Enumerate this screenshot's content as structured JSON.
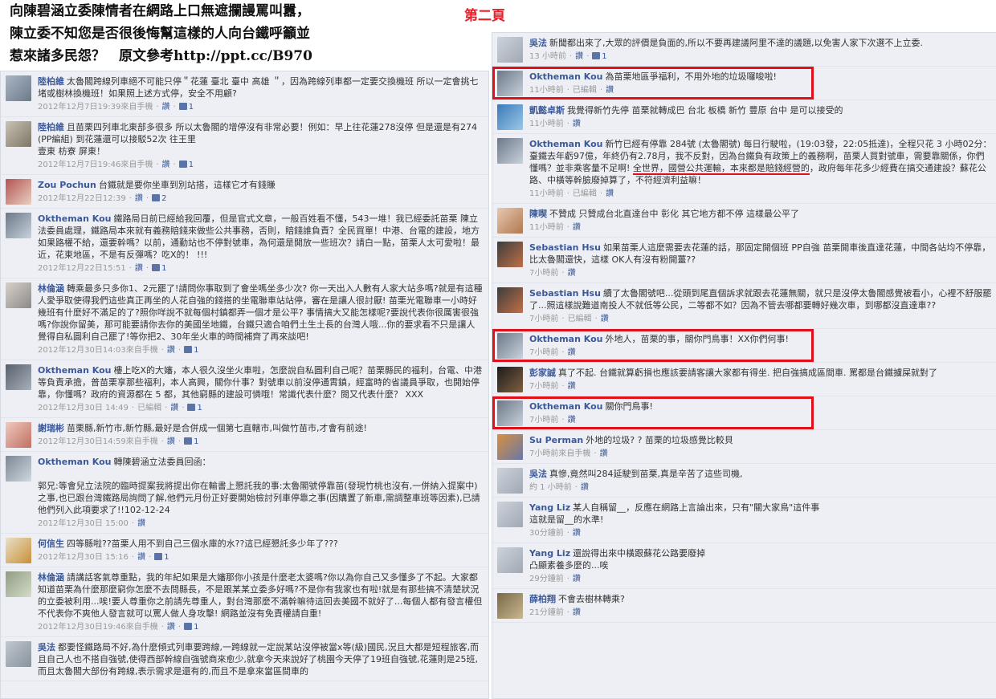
{
  "header": {
    "title_lines": [
      "向陳碧涵立委陳情者在網路上口無遮攔謾罵叫囂，",
      "陳立委不知您是否很後悔幫這樣的人向台鐵呼籲並",
      "惹來諸多民怨？　原文參考http://ppt.cc/B970"
    ],
    "page_label": "第二頁"
  },
  "ui": {
    "like_label": "讚",
    "edited_label": "已編輯",
    "sep": "·"
  },
  "left_comments": [
    {
      "author": "陸柏維",
      "text": "太魯閣跨線列車絕不可能只停＂花蓮 臺北 臺中 高雄 ＂，因為跨線列車都一定要交換機班 所以一定會挑七堵或樹林換機班！如果照上述方式停，安全不用顧?",
      "time": "2012年12月7日19:39來自手機",
      "likes": "1"
    },
    {
      "author": "陸柏維",
      "text": "且苗栗四列車北東部多很多 所以太魯閣的增停沒有非常必要！例如：早上往花蓮278沒停 但是還是有274(PP編組) 到花蓮還可以接駁52次 往王里\n壹東 枋寮 屏東！",
      "time": "2012年12月7日19:46來自手機",
      "likes": "1"
    },
    {
      "author": "Zou Pochun",
      "text": "台鐵就是要你坐車到別站搭，這樣它才有錢賺",
      "time": "2012年12月22日12:39",
      "likes": "2"
    },
    {
      "author": "Oktheman Kou",
      "text": "鐵路局日前已經給我回覆，但是官式文章，一般百姓看不懂，543一堆！我已經委託苗栗 陳立法委員處理，鐵路局本來就有義務賠錢來做些公共事務，否則，賠錢誰負責？全民買單！中港、台電的建設，地方如果路權不給，還要幹嗎？以前，通勤站也不停對號車，為何還是開放一些班次？請白一點，苗栗人太可愛啦！最近，花東地區，不是有反彈嗎？吃X的！ !!!",
      "time": "2012年12月22日15:51",
      "likes": "1"
    },
    {
      "author": "林倫涵",
      "text": "轉乘最多只多你1、2元罷了!請問你事取到了會坐嗎坐多少次? 你一天出入人數有人家大站多嗎?就是有這種人愛爭取使得我們這些真正再坐的人花自強的錢搭的坐電聯車站站停，審在是讓人很討厭! 苗栗光電聯車一小時好幾班有什麼好不滿足的了?照你咩說不就每個村鎮都弄一個才是公平? 事情搞大又能怎樣呢?要說代表你很厲害很強嗎?你說你留美，那可能要請你去你的美國坐地鐵，台鐵只適合咱們土生土長的台灣人哦...你的要求看不只是讓人覺得自私圓利自己罷了!等你把2、30年坐火車的時間補齊了再來談吧!",
      "time": "2012年12月30日14:03來自手機",
      "likes": "1"
    },
    {
      "author": "Oktheman Kou",
      "text": "樓上吃X的大嬸，本人很久沒坐火車啦，怎麼說自私圓利自己呢？苗栗縣民的福利，台電、中港等負責承擔，普苗栗享那些福利，本人高興，關你什事？對號車以前沒停通霄鎮，經富時的省議員爭取，也開始停靠，你懂嗎？政府的資源都在 5 都，其他窮縣的建設可憐哦！常識代表什麼？閱又代表什麼？ XXX",
      "time": "2012年12月30日 14:49",
      "edited": true,
      "likes": "1"
    },
    {
      "author": "謝瑞彬",
      "text": "苗栗縣,新竹市,新竹縣,最好是合併成一個第七直轄市,叫做竹苗市,才會有前途!",
      "time": "2012年12月30日14:59來自手機",
      "likes": "1"
    },
    {
      "author": "Oktheman Kou",
      "text": "轉陳碧涵立法委員回函：\n\n郭兄:等會兒立法院的臨時提案我將提出你在輸書上懇託我的事:太魯閣號停靠苗(發現竹桃也沒有,一併納入提案中)之事,也已跟台灣鐵路局詢問了解,他們元月份正好要開始檢討列車停靠之事(因購置了新車,需調整車班等因素),已請他們列入此項要求了!!102-12-24",
      "time": "2012年12月30日 15:00",
      "likes": ""
    },
    {
      "author": "何信生",
      "text": "四等縣啦??苗栗人用不到自己三個水庫的水??這已經懇託多少年了???",
      "time": "2012年12月30日 15:16",
      "likes": "1"
    },
    {
      "author": "林倫涵",
      "text": "請講話客氣尊重點，我的年紀如果是大嬸那你小孩是什麼老太婆嗎?你以為你自己又多懂多了不起。大家都知道苗栗為什麼那麼窮你怎麼不去問縣長，不是跟某某立委多好嗎?不是你有我家也有啦!就是有那些搞不清楚狀況的立委被利用...唉!要人尊重你之前請先尊重人，對台灣那麼不滿幹嘛待這回去美國不就好了...每個人都有發言權但不代表你不爽他人發言就可以罵人做人身攻擊! 網路並沒有免責權請自重!",
      "time": "2012年12月30日19:46來自手機",
      "likes": "1"
    },
    {
      "author": "吳法",
      "text": "都要怪鐵路局不好,為什麼傾式列車要跨線,一跨線就一定說某站沒停被當x等(級)國民,況且大都是短程旅客,而且自己人也不搭自強號,使得西部幹線自強號商來愈少,就拿今天來說好了桃園今天停了19班自強號,花蓮則是25班,而且太魯閣大部份有跨線,表示需求是還有的,而且不是拿來當區間車的",
      "time": "",
      "likes": ""
    }
  ],
  "right_comments": [
    {
      "author": "吳法",
      "text": "新聞都出來了,大眾的評價是負面的,所以不要再建議阿里不達的議題,以免害人家下次選不上立委.",
      "time": "13 小時前",
      "likes": "1"
    },
    {
      "author": "Oktheman Kou",
      "text": "為苗栗地區爭福利，不用外地的垃圾囉唆啦!",
      "time": "11小時前",
      "edited": true,
      "likes": "",
      "highlight": true
    },
    {
      "author": "凱懿卓斯",
      "text": "我覺得新竹先停 苗栗就轉成巴 台北 板橋 新竹 豐原 台中 是可以接受的",
      "time": "11小時前",
      "likes": ""
    },
    {
      "author": "Oktheman Kou",
      "text": "新竹已經有停靠 284號 (太魯閣號) 每日行駛啦，(19:03發，22:05抵達)，全程只花 3 小時02分：臺鐵去年虧97億，年終仍有2.78月，我不反對，因為台鐵負有政策上的義務啊，苗栗人買對號車，需要靠關係，你們懂嗎？並非乘客量不足啊! 全世界，國營公共運輸，本來都是賠錢經營的，政府每年花多少經費在搞交通建設？蘇花公路、中橫等幹臉廢掉算了，不符經濟利益嘛！",
      "time": "11小時前",
      "edited": true,
      "likes": ""
    },
    {
      "author": "陳喫",
      "text": "不贊成 只贊成台北直達台中 彰化 其它地方都不停 這樣最公平了",
      "time": "11小時前",
      "likes": ""
    },
    {
      "author": "Sebastian Hsu",
      "text": "如果苗栗人這麼需要去花蓮的話，那固定開個班 PP自強 苗栗開車後直達花蓮，中間各站均不停靠，比太魯閣還快，這樣 OK人有沒有粉開薑??",
      "time": "7小時前",
      "likes": ""
    },
    {
      "author": "Sebastian Hsu",
      "text": "續了太魯閣號吧...從頭到尾直個訴求就跟去花蓮無關，就只是沒停太魯閣感覺被看小，心裡不舒服罷了...照這樣說難道南投人不就低等公民，二等都不如？因為不管去哪都要轉好幾次車，到哪都沒直達車??",
      "time": "7小時前",
      "edited": true,
      "likes": ""
    },
    {
      "author": "Oktheman Kou",
      "text": "外地人，苗栗的事，關你門鳥事！XX你們何事!",
      "time": "7小時前",
      "likes": "",
      "highlight": true
    },
    {
      "author": "彭家誠",
      "text": "真了不起. 台鐵就算虧損也應該要請客讓大家都有得坐. 把自強搞成區間車. 罵都是台鐵擄屎就對了",
      "time": "7小時前",
      "likes": ""
    },
    {
      "author": "Oktheman Kou",
      "text": "關你門鳥事!",
      "time": "7小時前",
      "likes": "",
      "highlight": true
    },
    {
      "author": "Su Perman",
      "text": "外地的垃圾? ? 苗栗的垃圾感覺比較貝",
      "time": "7小時前來自手機",
      "likes": ""
    },
    {
      "author": "吳法",
      "text": "真慘,竟然叫284延駛到苗栗,真是辛苦了這些司機,",
      "time": "約 1 小時前",
      "likes": ""
    },
    {
      "author": "Yang Liz",
      "text": "某人自稱留__，反應在網路上言論出來，只有\"關大家鳥\"這件事\n這就是留__的水準!",
      "time": "30分鐘前",
      "likes": ""
    },
    {
      "author": "Yang Liz",
      "text": "還說得出來中橫跟蘇花公路要廢掉\n凸顯素養多麼的...唉",
      "time": "29分鐘前",
      "likes": ""
    },
    {
      "author": "薛柏翔",
      "text": "不會去樹林轉乘?",
      "time": "21分鐘前",
      "likes": ""
    }
  ]
}
